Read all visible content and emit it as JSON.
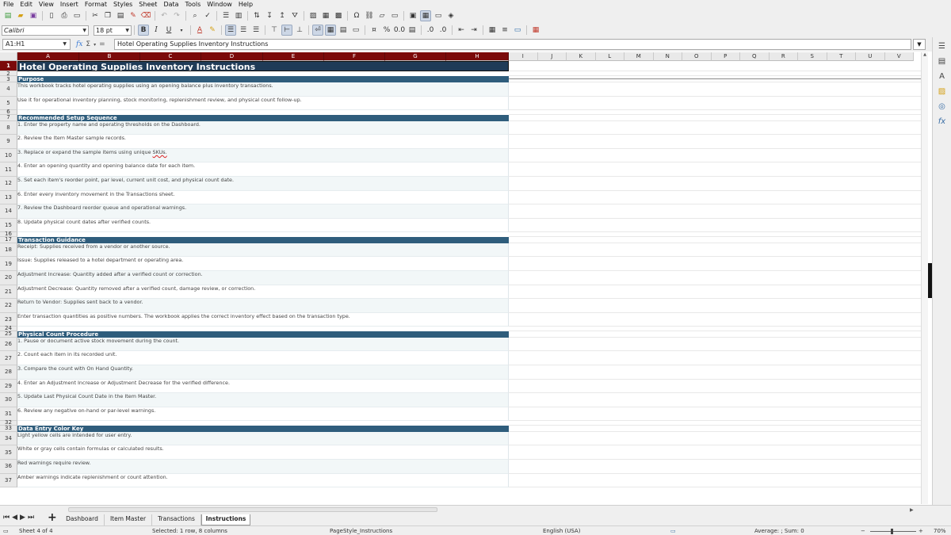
{
  "menu": [
    "File",
    "Edit",
    "View",
    "Insert",
    "Format",
    "Styles",
    "Sheet",
    "Data",
    "Tools",
    "Window",
    "Help"
  ],
  "toolbar2": {
    "font_name": "Calibri",
    "font_size": "18 pt"
  },
  "formula_bar": {
    "name_box": "A1:H1",
    "formula": "Hotel Operating Supplies Inventory Instructions"
  },
  "columns": [
    "A",
    "B",
    "C",
    "D",
    "E",
    "F",
    "G",
    "H",
    "I",
    "J",
    "K",
    "L",
    "M",
    "N",
    "O",
    "P",
    "Q",
    "R",
    "S",
    "T",
    "U",
    "V"
  ],
  "rows": [
    {
      "n": "1",
      "type": "title",
      "text": "Hotel Operating Supplies Inventory Instructions"
    },
    {
      "n": "2",
      "type": "empty",
      "text": ""
    },
    {
      "n": "3",
      "type": "sect",
      "text": "Purpose"
    },
    {
      "n": "4",
      "type": "body",
      "text": "This workbook tracks hotel operating supplies using an opening balance plus inventory transactions."
    },
    {
      "n": "5",
      "type": "body",
      "text": "Use it for operational inventory planning, stock monitoring, replenishment review, and physical count follow-up."
    },
    {
      "n": "6",
      "type": "empty",
      "text": ""
    },
    {
      "n": "7",
      "type": "sect",
      "text": "Recommended Setup Sequence"
    },
    {
      "n": "8",
      "type": "body",
      "text": "1. Enter the property name and operating thresholds on the Dashboard."
    },
    {
      "n": "9",
      "type": "body",
      "text": "2. Review the Item Master sample records."
    },
    {
      "n": "10",
      "type": "body",
      "text": "3. Replace or expand the sample items using unique SKUs."
    },
    {
      "n": "11",
      "type": "body",
      "text": "4. Enter an opening quantity and opening balance date for each item."
    },
    {
      "n": "12",
      "type": "body",
      "text": "5. Set each item's reorder point, par level, current unit cost, and physical count date."
    },
    {
      "n": "13",
      "type": "body",
      "text": "6. Enter every inventory movement in the Transactions sheet."
    },
    {
      "n": "14",
      "type": "body",
      "text": "7. Review the Dashboard reorder queue and operational warnings."
    },
    {
      "n": "15",
      "type": "body",
      "text": "8. Update physical count dates after verified counts."
    },
    {
      "n": "16",
      "type": "empty",
      "text": ""
    },
    {
      "n": "17",
      "type": "sect",
      "text": "Transaction Guidance"
    },
    {
      "n": "18",
      "type": "body",
      "text": "Receipt: Supplies received from a vendor or another source."
    },
    {
      "n": "19",
      "type": "body",
      "text": "Issue: Supplies released to a hotel department or operating area."
    },
    {
      "n": "20",
      "type": "body",
      "text": "Adjustment Increase: Quantity added after a verified count or correction."
    },
    {
      "n": "21",
      "type": "body",
      "text": "Adjustment Decrease: Quantity removed after a verified count, damage review, or correction."
    },
    {
      "n": "22",
      "type": "body",
      "text": "Return to Vendor: Supplies sent back to a vendor."
    },
    {
      "n": "23",
      "type": "body",
      "text": "Enter transaction quantities as positive numbers. The workbook applies the correct inventory effect based on the transaction type."
    },
    {
      "n": "24",
      "type": "empty",
      "text": ""
    },
    {
      "n": "25",
      "type": "sect",
      "text": "Physical Count Procedure"
    },
    {
      "n": "26",
      "type": "body",
      "text": "1. Pause or document active stock movement during the count."
    },
    {
      "n": "27",
      "type": "body",
      "text": "2. Count each item in its recorded unit."
    },
    {
      "n": "28",
      "type": "body",
      "text": "3. Compare the count with On Hand Quantity."
    },
    {
      "n": "29",
      "type": "body",
      "text": "4. Enter an Adjustment Increase or Adjustment Decrease for the verified difference."
    },
    {
      "n": "30",
      "type": "body",
      "text": "5. Update Last Physical Count Date in the Item Master."
    },
    {
      "n": "31",
      "type": "body",
      "text": "6. Review any negative on-hand or par-level warnings."
    },
    {
      "n": "32",
      "type": "empty",
      "text": ""
    },
    {
      "n": "33",
      "type": "sect",
      "text": "Data Entry Color Key"
    },
    {
      "n": "34",
      "type": "body",
      "text": "Light yellow cells are intended for user entry."
    },
    {
      "n": "35",
      "type": "body",
      "text": "White or gray cells contain formulas or calculated results."
    },
    {
      "n": "36",
      "type": "body",
      "text": "Red warnings require review."
    },
    {
      "n": "37",
      "type": "body",
      "text": "Amber warnings indicate replenishment or count attention."
    }
  ],
  "sheet_tabs": [
    "Dashboard",
    "Item Master",
    "Transactions",
    "Instructions"
  ],
  "active_tab": "Instructions",
  "status": {
    "sheet": "Sheet 4 of 4",
    "selection": "Selected: 1 row, 8 columns",
    "page_style": "PageStyle_Instructions",
    "language": "English (USA)",
    "summary": "Average: ; Sum: 0",
    "zoom": "70%"
  },
  "colors": {
    "header_selected": "#7b0a0a",
    "title_fill": "#1f3b57",
    "section_fill": "#2f5d7c",
    "body_alt": "#f2f7f8"
  }
}
